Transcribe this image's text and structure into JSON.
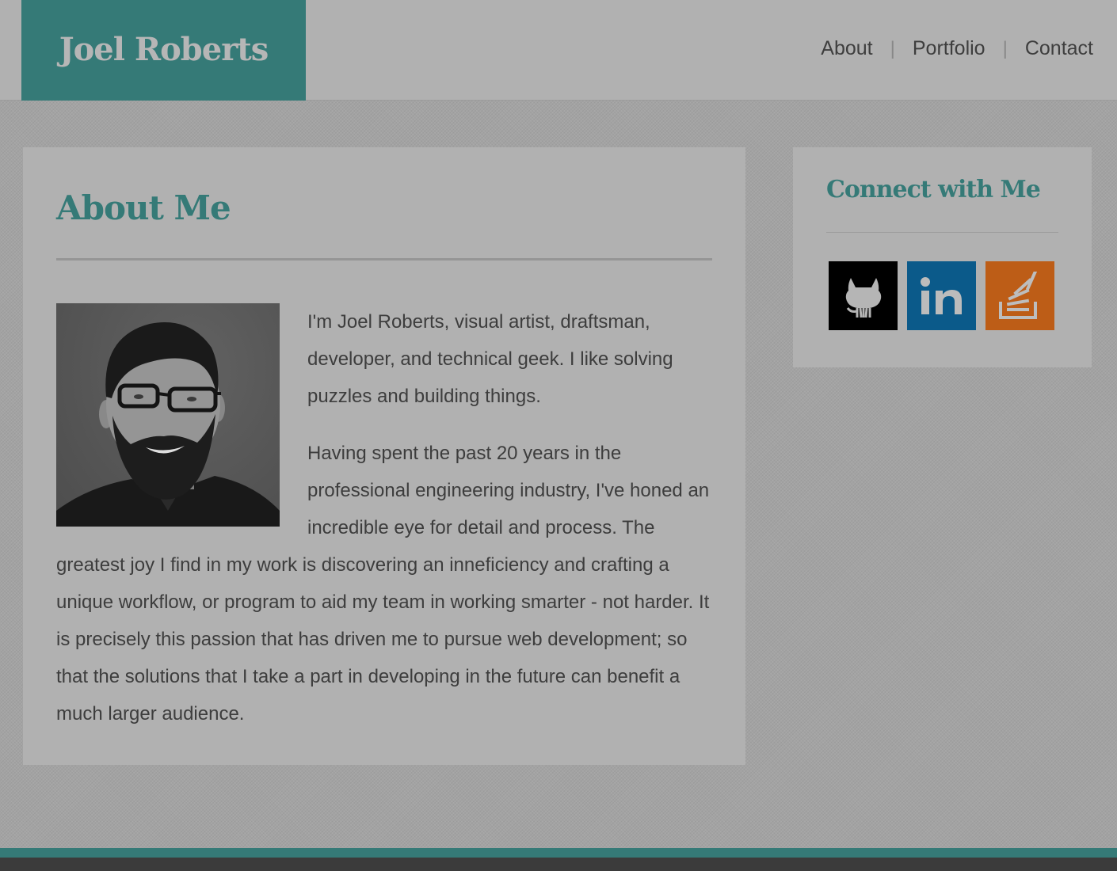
{
  "header": {
    "brand": "Joel Roberts",
    "nav": [
      {
        "label": "About"
      },
      {
        "label": "Portfolio"
      },
      {
        "label": "Contact"
      }
    ],
    "separator": "|"
  },
  "about": {
    "title": "About Me",
    "paragraphs": [
      "I'm Joel Roberts, visual artist, draftsman, developer, and technical geek. I like solving puzzles and building things.",
      "Having spent the past 20 years in the professional engineering industry, I've honed an incredible eye for detail and process. The greatest joy I find in my work is discovering an inneficiency and crafting a unique workflow, or program to aid my team in working smarter - not harder. It is precisely this passion that has driven me to pursue web development; so that the solutions that I take a part in developing in the future can benefit a much larger audience."
    ]
  },
  "connect": {
    "title": "Connect with Me",
    "links": [
      {
        "icon": "github-icon",
        "color": "#000000"
      },
      {
        "icon": "linkedin-icon",
        "color": "#0b5a8a"
      },
      {
        "icon": "stackoverflow-icon",
        "color": "#bd5d17"
      }
    ]
  },
  "colors": {
    "accent": "#357a77",
    "page_background": "#a3a3a3",
    "card_background": "#b1b1b1",
    "footer": "#3b3b3b"
  }
}
